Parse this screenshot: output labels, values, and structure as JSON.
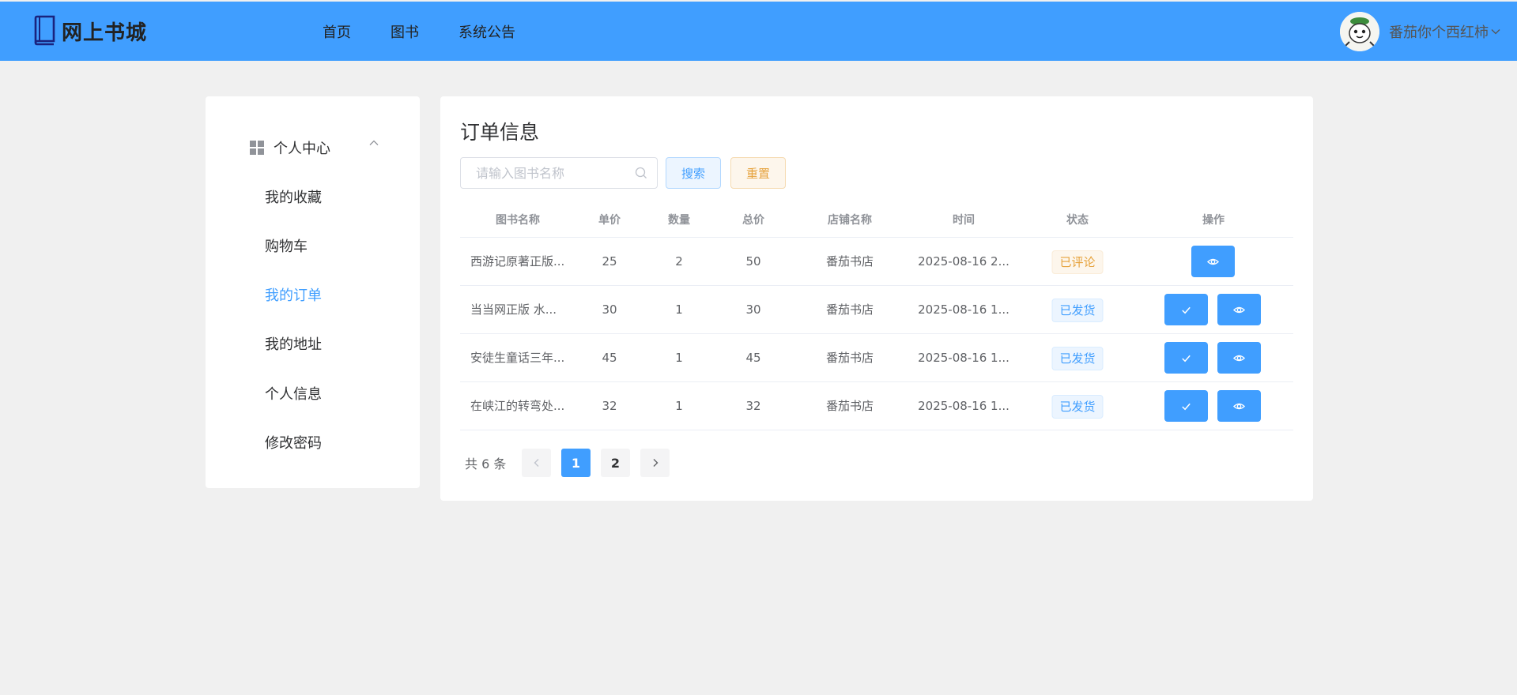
{
  "app": {
    "title": "网上书城",
    "nav": [
      "首页",
      "图书",
      "系统公告"
    ],
    "user_name": "番茄你个西红柿",
    "brand_color": "#409eff"
  },
  "sidebar": {
    "group_label": "个人中心",
    "items": [
      {
        "label": "我的收藏",
        "active": false
      },
      {
        "label": "购物车",
        "active": false
      },
      {
        "label": "我的订单",
        "active": true
      },
      {
        "label": "我的地址",
        "active": false
      },
      {
        "label": "个人信息",
        "active": false
      },
      {
        "label": "修改密码",
        "active": false
      }
    ]
  },
  "main": {
    "title": "订单信息",
    "search": {
      "placeholder": "请输入图书名称",
      "button": "搜索",
      "reset": "重置"
    },
    "table": {
      "columns": [
        "图书名称",
        "单价",
        "数量",
        "总价",
        "店铺名称",
        "时间",
        "状态",
        "操作"
      ],
      "rows": [
        {
          "name": "西游记原著正版...",
          "price": "25",
          "qty": "2",
          "total": "50",
          "shop": "番茄书店",
          "time": "2025-08-16 2...",
          "status": "已评论",
          "status_type": "warning",
          "actions": [
            "view"
          ]
        },
        {
          "name": "当当网正版 水...",
          "price": "30",
          "qty": "1",
          "total": "30",
          "shop": "番茄书店",
          "time": "2025-08-16 1...",
          "status": "已发货",
          "status_type": "info",
          "actions": [
            "confirm",
            "view"
          ]
        },
        {
          "name": "安徒生童话三年...",
          "price": "45",
          "qty": "1",
          "total": "45",
          "shop": "番茄书店",
          "time": "2025-08-16 1...",
          "status": "已发货",
          "status_type": "info",
          "actions": [
            "confirm",
            "view"
          ]
        },
        {
          "name": "在峡江的转弯处...",
          "price": "32",
          "qty": "1",
          "total": "32",
          "shop": "番茄书店",
          "time": "2025-08-16 1...",
          "status": "已发货",
          "status_type": "info",
          "actions": [
            "confirm",
            "view"
          ]
        }
      ]
    },
    "pagination": {
      "total_text": "共 6 条",
      "pages": [
        "1",
        "2"
      ],
      "current": "1"
    }
  }
}
